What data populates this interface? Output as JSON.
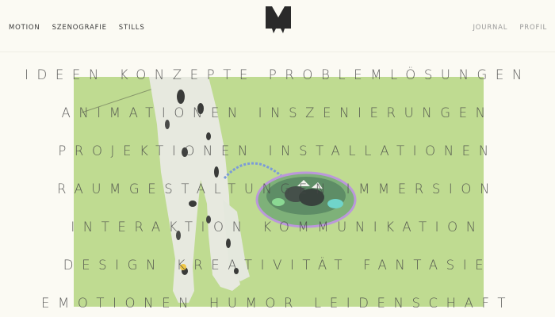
{
  "nav": {
    "left": [
      "MOTION",
      "SZENOGRAFIE",
      "STILLS"
    ],
    "right": [
      "JOURNAL",
      "PROFIL"
    ]
  },
  "logo": {
    "icon": "m-logo-icon"
  },
  "keywords": [
    "IDEEN KONZEPTE PROBLEMLÖSUNGEN",
    "ANIMATIONEN INSZENIERUNGEN",
    "PROJEKTIONEN INSTALLATIONEN",
    "RAUMGESTALTUNGEN IMMERSION",
    "INTERAKTION KOMMUNIKATION",
    "DESIGN KREATIVITÄT FANTASIE",
    "EMOTIONEN HUMOR LEIDENSCHAFT"
  ],
  "colors": {
    "background": "#fbfaf3",
    "hero": "#b8d785",
    "text": "#464646"
  }
}
